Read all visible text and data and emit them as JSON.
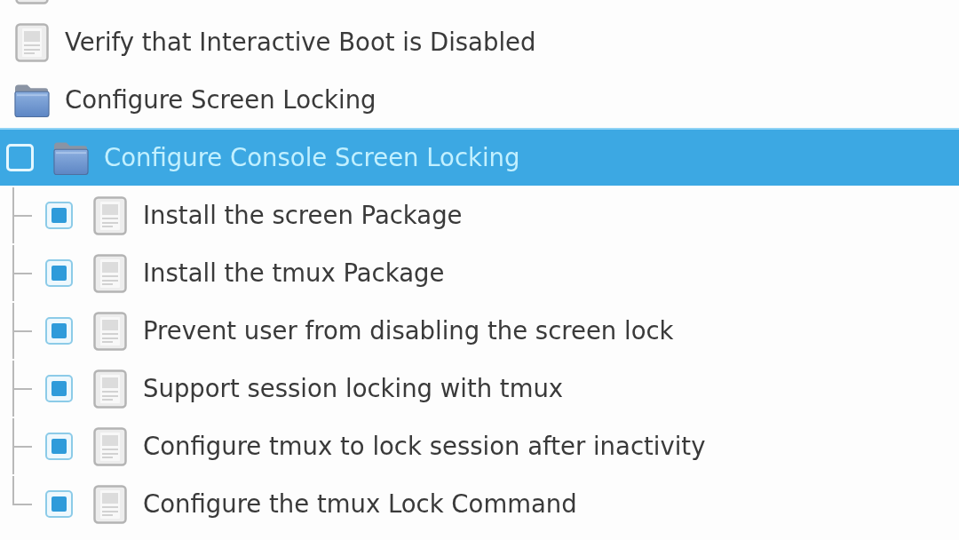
{
  "tree": {
    "items": [
      {
        "kind": "rule",
        "selected": false
      },
      {
        "kind": "rule",
        "label": "Verify that Interactive Boot is Disabled",
        "selected": false
      },
      {
        "kind": "group",
        "label": "Configure Screen Locking",
        "selected": false,
        "children": [
          {
            "kind": "group",
            "label": "Configure Console Screen Locking",
            "selected": true,
            "checked": false,
            "children": [
              {
                "kind": "rule",
                "label": "Install the screen Package",
                "selected": false,
                "checked": true
              },
              {
                "kind": "rule",
                "label": "Install the tmux Package",
                "selected": false,
                "checked": true
              },
              {
                "kind": "rule",
                "label": "Prevent user from disabling the screen lock",
                "selected": false,
                "checked": true
              },
              {
                "kind": "rule",
                "label": "Support session locking with tmux",
                "selected": false,
                "checked": true
              },
              {
                "kind": "rule",
                "label": "Configure tmux to lock session after inactivity",
                "selected": false,
                "checked": true
              },
              {
                "kind": "rule",
                "label": "Configure the tmux Lock Command",
                "selected": false,
                "checked": true
              }
            ]
          }
        ]
      }
    ]
  }
}
